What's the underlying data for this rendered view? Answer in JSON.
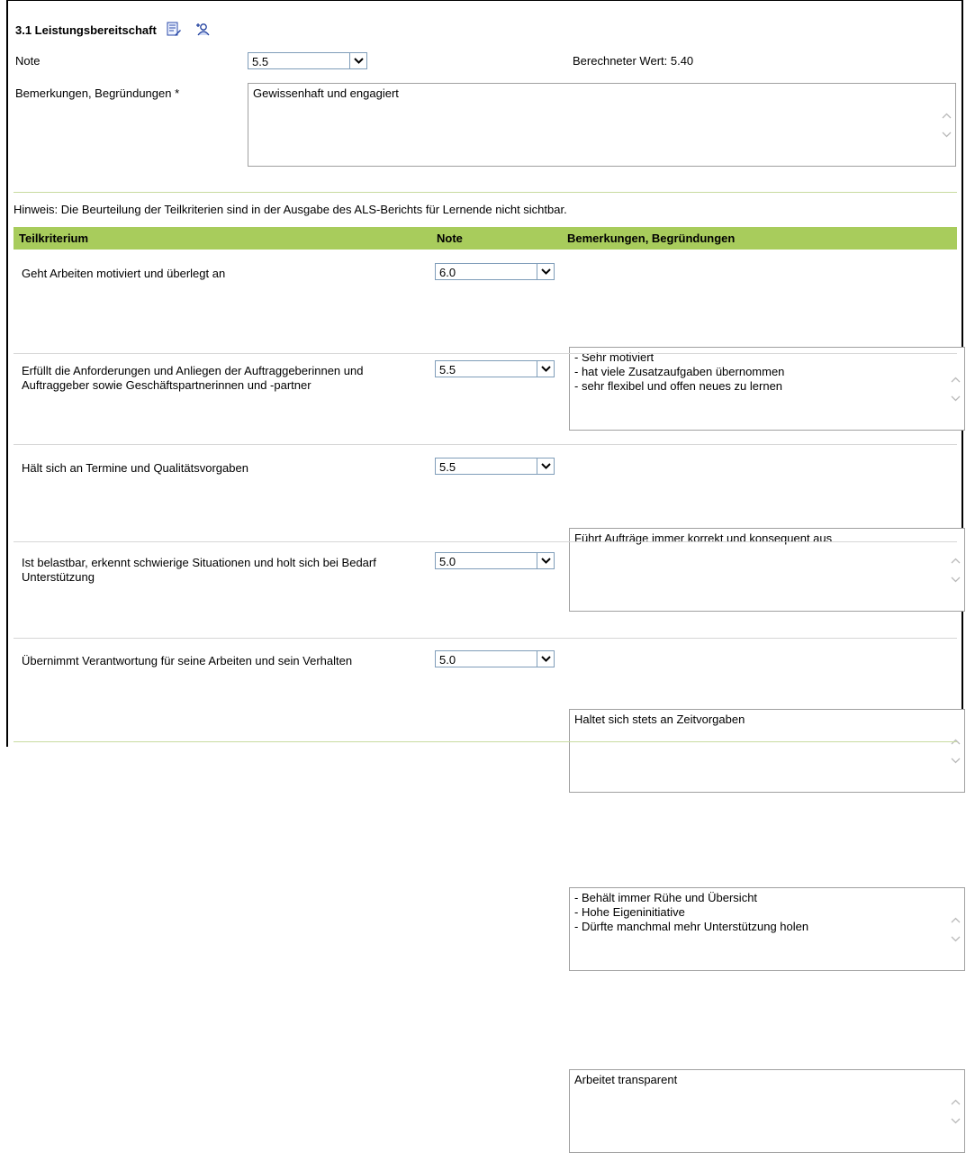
{
  "section": {
    "title": "3.1 Leistungsbereitschaft",
    "edit_icon": "edit-notes-icon",
    "search_icon": "person-search-icon"
  },
  "note_field": {
    "label": "Note",
    "value": "5.5",
    "calculated_label": "Berechneter Wert: 5.40"
  },
  "remarks_field": {
    "label": "Bemerkungen, Begründungen *",
    "value": "Gewissenhaft und engagiert"
  },
  "hint": "Hinweis: Die Beurteilung der Teilkriterien sind in der Ausgabe des ALS-Berichts für Lernende nicht sichtbar.",
  "table": {
    "headers": [
      "Teilkriterium",
      "Note",
      "Bemerkungen, Begründungen"
    ],
    "rows": [
      {
        "criterion": "Geht Arbeiten motiviert und überlegt an",
        "grade": "6.0",
        "remark": "- Sehr motiviert\n- hat viele Zusatzaufgaben übernommen\n- sehr flexibel und offen neues zu lernen"
      },
      {
        "criterion": "Erfüllt die Anforderungen und Anliegen der Auftraggeberinnen und Auftraggeber sowie Geschäftspartnerinnen und -partner",
        "grade": "5.5",
        "remark": "Führt Aufträge immer korrekt und konsequent aus"
      },
      {
        "criterion": "Hält sich an Termine und Qualitätsvorgaben",
        "grade": "5.5",
        "remark": "Haltet sich stets an Zeitvorgaben"
      },
      {
        "criterion": "Ist belastbar, erkennt schwierige Situationen und holt sich bei Bedarf Unterstützung",
        "grade": "5.0",
        "remark": "- Behält immer Rühe und Übersicht\n- Hohe Eigeninitiative\n- Dürfte manchmal mehr Unterstützung holen"
      },
      {
        "criterion": "Übernimmt Verantwortung für seine Arbeiten und sein Verhalten",
        "grade": "5.0",
        "remark": "Arbeitet transparent"
      }
    ]
  },
  "colors": {
    "header_green": "#a8cc5c",
    "divider_green": "#c8dba0"
  }
}
